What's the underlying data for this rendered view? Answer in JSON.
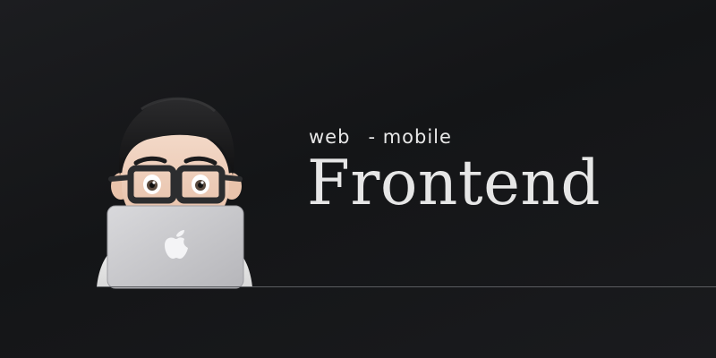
{
  "banner": {
    "tagline": {
      "primary": "web",
      "secondary": "- mobile"
    },
    "title": "Frontend",
    "avatar": {
      "icon": "developer-memoji-with-laptop",
      "laptop_icon": "apple-logo-icon"
    },
    "colors": {
      "background": "#17181a",
      "text": "#e6e6e6",
      "laptop": "#c8c8cc"
    }
  }
}
